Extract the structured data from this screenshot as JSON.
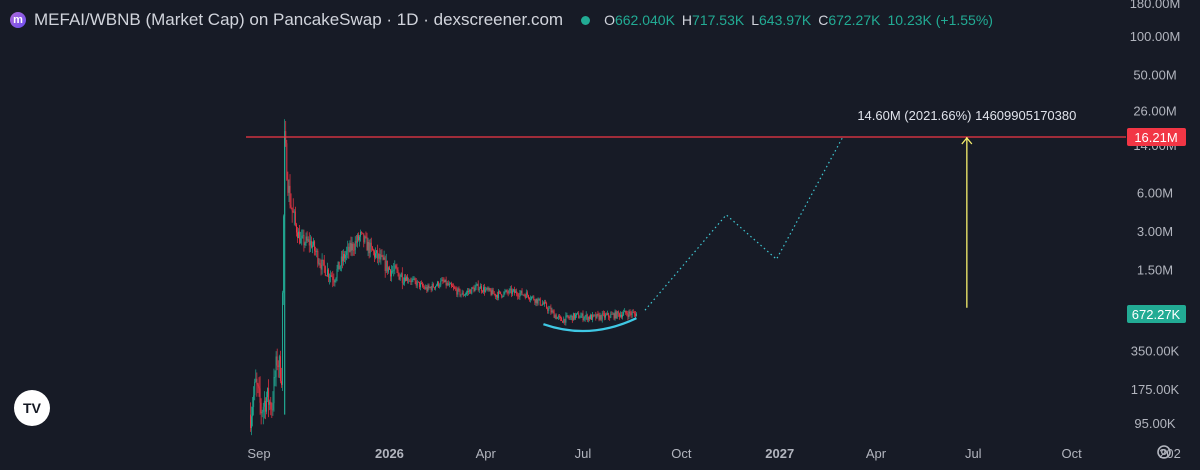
{
  "header": {
    "logo_letter": "m",
    "title": "MEFAI/WBNB (Market Cap) on PancakeSwap · 1D · dexscreener.com",
    "open_label": "O",
    "open_value": "662.040K",
    "high_label": "H",
    "high_value": "717.53K",
    "low_label": "L",
    "low_value": "643.97K",
    "close_label": "C",
    "close_value": "672.27K",
    "change": "10.23K (+1.55%)",
    "status_color": "#22ab94"
  },
  "watermark": {
    "text": "TV"
  },
  "chart_data": {
    "type": "candlestick",
    "y_scale": "log",
    "y_ticks": [
      "180.00M",
      "100.00M",
      "50.00M",
      "26.00M",
      "14.00M",
      "6.00M",
      "3.00M",
      "1.50M",
      "350.00K",
      "175.00K",
      "95.00K"
    ],
    "x_ticks": [
      "Sep",
      "2026",
      "Apr",
      "Jul",
      "Oct",
      "2027",
      "Apr",
      "Jul",
      "Oct",
      "202"
    ],
    "series": [
      {
        "kind": "candles_summary",
        "points": [
          {
            "x": "2025-08-24",
            "y": 110000
          },
          {
            "x": "2025-08-29",
            "y": 190000
          },
          {
            "x": "2025-09-03",
            "y": 120000
          },
          {
            "x": "2025-09-08",
            "y": 150000
          },
          {
            "x": "2025-09-13",
            "y": 130000
          },
          {
            "x": "2025-09-18",
            "y": 300000
          },
          {
            "x": "2025-09-22",
            "y": 230000
          },
          {
            "x": "2025-09-25",
            "y": 15000000
          },
          {
            "x": "2025-09-29",
            "y": 6000000
          },
          {
            "x": "2025-10-04",
            "y": 3500000
          },
          {
            "x": "2025-10-10",
            "y": 2500000
          },
          {
            "x": "2025-10-20",
            "y": 2400000
          },
          {
            "x": "2025-10-30",
            "y": 1600000
          },
          {
            "x": "2025-11-10",
            "y": 1300000
          },
          {
            "x": "2025-11-20",
            "y": 1900000
          },
          {
            "x": "2025-12-05",
            "y": 2700000
          },
          {
            "x": "2025-12-15",
            "y": 2100000
          },
          {
            "x": "2026-01-01",
            "y": 1500000
          },
          {
            "x": "2026-01-20",
            "y": 1250000
          },
          {
            "x": "2026-02-05",
            "y": 1050000
          },
          {
            "x": "2026-02-20",
            "y": 1200000
          },
          {
            "x": "2026-03-10",
            "y": 950000
          },
          {
            "x": "2026-03-25",
            "y": 1100000
          },
          {
            "x": "2026-04-10",
            "y": 950000
          },
          {
            "x": "2026-04-25",
            "y": 1000000
          },
          {
            "x": "2026-05-10",
            "y": 950000
          },
          {
            "x": "2026-05-25",
            "y": 800000
          },
          {
            "x": "2026-06-10",
            "y": 600000
          },
          {
            "x": "2026-06-25",
            "y": 650000
          },
          {
            "x": "2026-07-10",
            "y": 630000
          },
          {
            "x": "2026-07-25",
            "y": 650000
          },
          {
            "x": "2026-08-10",
            "y": 680000
          },
          {
            "x": "2026-08-20",
            "y": 672270
          }
        ]
      },
      {
        "kind": "projection_path",
        "points": [
          {
            "x": "2026-08-28",
            "y": 720000
          },
          {
            "x": "2026-11-12",
            "y": 4000000
          },
          {
            "x": "2026-12-29",
            "y": 1800000
          },
          {
            "x": "2027-03-01",
            "y": 16210000
          }
        ]
      }
    ],
    "horizontal_line": {
      "value": 16210000,
      "label": "16.21M",
      "color": "#f23645"
    },
    "current_price": {
      "value": 672270,
      "label": "672.27K",
      "color": "#22ab94"
    },
    "measure_arrow": {
      "x": "2027-06-25",
      "from": 700000,
      "to": 16210000,
      "color": "#f7f06d"
    },
    "measure_label": "14.60M (2021.66%) 14609905170380",
    "annotation_curve": {
      "from": "2026-05-25",
      "to": "2026-08-20",
      "low": 480000,
      "color": "#3fc8e4"
    },
    "up_color": "#22ab94",
    "down_color": "#f23645",
    "grid": false
  }
}
